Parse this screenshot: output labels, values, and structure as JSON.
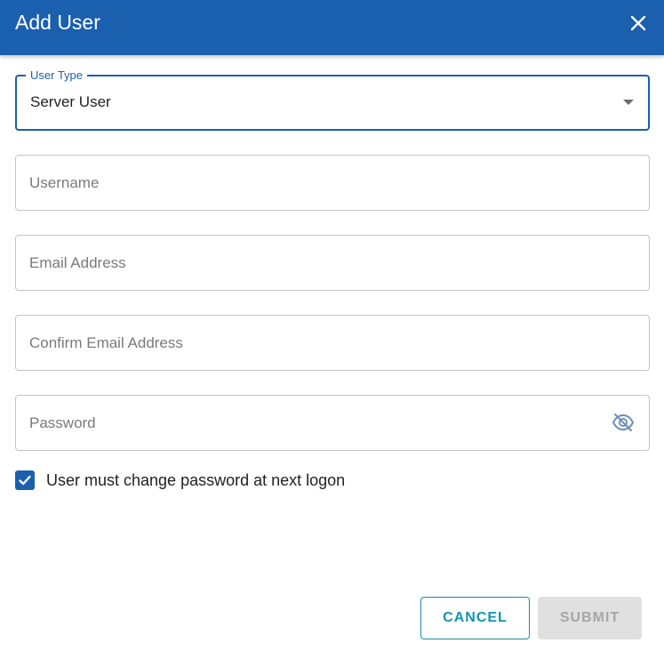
{
  "dialog": {
    "title": "Add User"
  },
  "form": {
    "user_type": {
      "label": "User Type",
      "value": "Server User"
    },
    "username": {
      "placeholder": "Username",
      "value": ""
    },
    "email": {
      "placeholder": "Email Address",
      "value": ""
    },
    "confirm_email": {
      "placeholder": "Confirm Email Address",
      "value": ""
    },
    "password": {
      "placeholder": "Password",
      "value": "",
      "visibility_icon": "eye-off-icon"
    },
    "must_change_password": {
      "label": "User must change password at next logon",
      "checked": true
    }
  },
  "actions": {
    "cancel_label": "CANCEL",
    "submit_label": "SUBMIT",
    "submit_disabled": true
  },
  "colors": {
    "primary": "#1b5faf",
    "cancel_accent": "#1592b3",
    "disabled_bg": "#e0e0e0"
  }
}
